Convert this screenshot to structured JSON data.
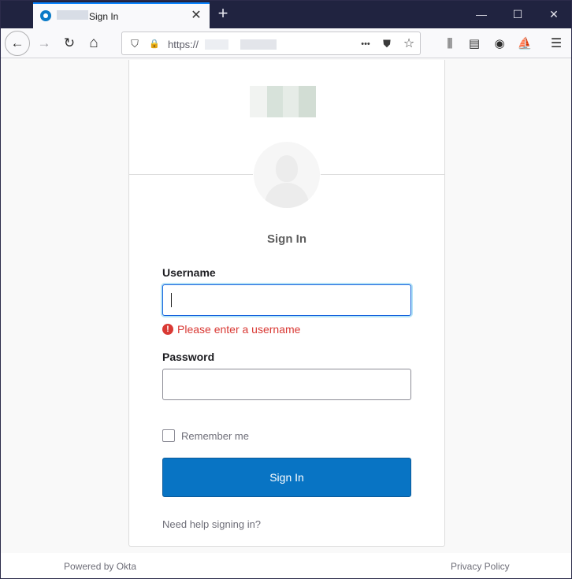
{
  "browser": {
    "tab_title": "Sign In",
    "tab_close": "✕",
    "new_tab": "+",
    "window_controls": {
      "minimize": "—",
      "maximize": "☐",
      "close": "✕"
    },
    "url_prefix": "https://",
    "nav": {
      "back": "←",
      "forward": "→",
      "reload": "↻",
      "home": "⌂"
    },
    "url_icons": {
      "shield": "⛉",
      "lock": "🔒",
      "more": "•••",
      "pocket": "⛊",
      "star": "☆"
    },
    "toolbar_icons": {
      "library": "⫼",
      "sidebar": "▤",
      "account": "◉",
      "extension": "⛵",
      "menu": "☰"
    }
  },
  "signin": {
    "title": "Sign In",
    "username_label": "Username",
    "username_value": "",
    "error_icon": "!",
    "error_text": "Please enter a username",
    "password_label": "Password",
    "password_value": "",
    "remember_label": "Remember me",
    "submit_label": "Sign In",
    "help_link": "Need help signing in?"
  },
  "footer": {
    "powered_by": "Powered by Okta",
    "privacy": "Privacy Policy"
  },
  "colors": {
    "accent": "#0874c4",
    "error": "#d93934",
    "focus_ring": "#b6e4f7"
  }
}
